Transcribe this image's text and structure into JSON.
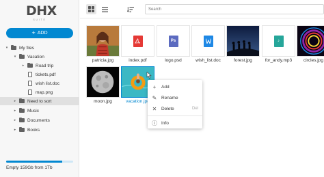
{
  "logo": {
    "text": "DHX",
    "subtext": "SUITE"
  },
  "add_button": {
    "label": "ADD",
    "icon": "plus-icon"
  },
  "tree": [
    {
      "label": "My files",
      "level": 0,
      "arrow": "▾",
      "type": "folder"
    },
    {
      "label": "Vacation",
      "level": 1,
      "arrow": "▾",
      "type": "folder"
    },
    {
      "label": "Road trip",
      "level": 2,
      "arrow": "▸",
      "type": "folder"
    },
    {
      "label": "tickets.pdf",
      "level": 2,
      "arrow": "",
      "type": "file"
    },
    {
      "label": "wish list.doc",
      "level": 2,
      "arrow": "",
      "type": "file"
    },
    {
      "label": "map.png",
      "level": 2,
      "arrow": "",
      "type": "file"
    },
    {
      "label": "Need to sort",
      "level": 1,
      "arrow": "▸",
      "type": "folder",
      "selected": true
    },
    {
      "label": "Music",
      "level": 1,
      "arrow": "▸",
      "type": "folder"
    },
    {
      "label": "Documents",
      "level": 1,
      "arrow": "▸",
      "type": "folder"
    },
    {
      "label": "Books",
      "level": 1,
      "arrow": "▸",
      "type": "folder"
    }
  ],
  "storage": {
    "text": "Empty 159Gb from 1Tb",
    "used_fraction": 0.84
  },
  "toolbar": {
    "search_placeholder": "Search",
    "grid_icon": "grid-view-icon",
    "list_icon": "list-view-icon",
    "sort_icon": "sort-icon"
  },
  "files": [
    {
      "name": "patricia.jpg",
      "kind": "photo-person"
    },
    {
      "name": "index.pdf",
      "kind": "pdf",
      "color": "#e53935"
    },
    {
      "name": "logo.psd",
      "kind": "psd",
      "color": "#5c6bc0",
      "glyph": "Ps"
    },
    {
      "name": "wish_list.doc",
      "kind": "doc",
      "color": "#1e88e5"
    },
    {
      "name": "forest.jpg",
      "kind": "photo-night"
    },
    {
      "name": "for_andy.mp3",
      "kind": "mp3",
      "color": "#26a69a",
      "glyph": "♪"
    },
    {
      "name": "circles.jpg",
      "kind": "photo-circles"
    },
    {
      "name": "moon.jpg",
      "kind": "photo-moon"
    },
    {
      "name": "vacation.jpg",
      "kind": "photo-vacation",
      "selected": true
    }
  ],
  "context_menu": {
    "items": [
      {
        "label": "Add",
        "icon": "plus-icon",
        "glyph": "+"
      },
      {
        "label": "Rename",
        "icon": "pencil-icon",
        "glyph": "✎"
      },
      {
        "label": "Delete",
        "icon": "close-icon",
        "glyph": "✕",
        "hotkey": "Del"
      },
      {
        "label": "Info",
        "icon": "info-icon",
        "glyph": "ⓘ"
      }
    ]
  },
  "colors": {
    "accent": "#0288d1"
  }
}
